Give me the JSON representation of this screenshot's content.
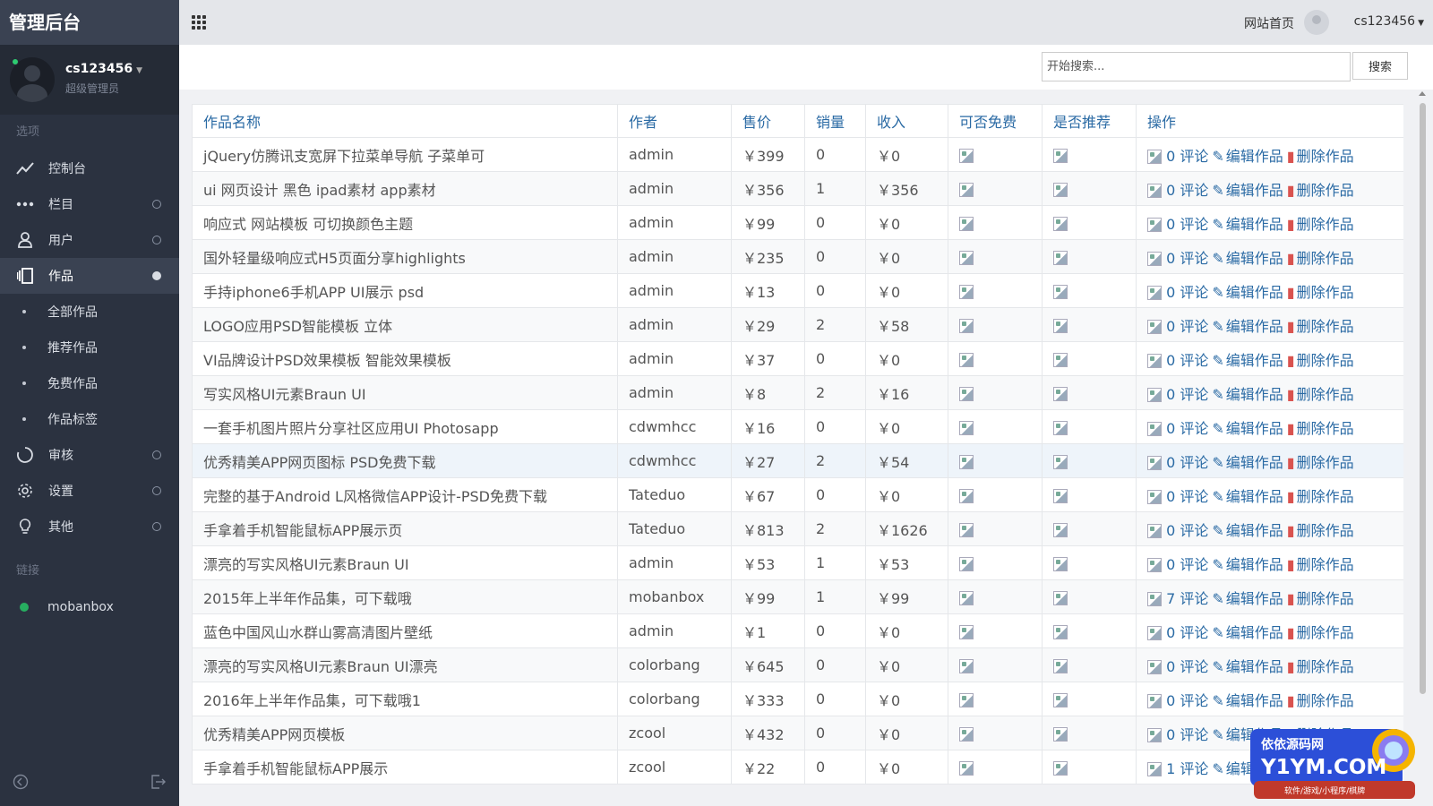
{
  "brand": {
    "title": "管理后台"
  },
  "profile": {
    "name": "cs123456",
    "role": "超级管理员"
  },
  "sidebar": {
    "section_options": "选项",
    "items": [
      {
        "label": "控制台",
        "icon": "trend-icon"
      },
      {
        "label": "栏目",
        "icon": "dots-icon"
      },
      {
        "label": "用户",
        "icon": "user-icon"
      },
      {
        "label": "作品",
        "icon": "works-icon"
      },
      {
        "label": "审核",
        "icon": "spinner-icon"
      },
      {
        "label": "设置",
        "icon": "gear-icon"
      },
      {
        "label": "其他",
        "icon": "bulb-icon"
      }
    ],
    "sub_items": [
      "全部作品",
      "推荐作品",
      "免费作品",
      "作品标签"
    ],
    "section_links": "链接",
    "link": "mobanbox"
  },
  "header": {
    "home_link": "网站首页",
    "user": "cs123456"
  },
  "search": {
    "placeholder": "开始搜索...",
    "button": "搜索"
  },
  "table": {
    "headers": [
      "作品名称",
      "作者",
      "售价",
      "销量",
      "收入",
      "可否免费",
      "是否推荐",
      "操作"
    ],
    "rows": [
      {
        "name": "jQuery仿腾讯支宽屏下拉菜单导航 子菜单可",
        "author": "admin",
        "price": "￥399",
        "sales": "0",
        "income": "￥0",
        "comments": "0 评论"
      },
      {
        "name": "ui 网页设计 黑色 ipad素材 app素材",
        "author": "admin",
        "price": "￥356",
        "sales": "1",
        "income": "￥356",
        "comments": "0 评论"
      },
      {
        "name": "响应式 网站模板 可切换颜色主题",
        "author": "admin",
        "price": "￥99",
        "sales": "0",
        "income": "￥0",
        "comments": "0 评论"
      },
      {
        "name": "国外轻量级响应式H5页面分享highlights",
        "author": "admin",
        "price": "￥235",
        "sales": "0",
        "income": "￥0",
        "comments": "0 评论"
      },
      {
        "name": "手持iphone6手机APP UI展示 psd",
        "author": "admin",
        "price": "￥13",
        "sales": "0",
        "income": "￥0",
        "comments": "0 评论"
      },
      {
        "name": "LOGO应用PSD智能模板 立体",
        "author": "admin",
        "price": "￥29",
        "sales": "2",
        "income": "￥58",
        "comments": "0 评论"
      },
      {
        "name": "VI品牌设计PSD效果模板 智能效果模板",
        "author": "admin",
        "price": "￥37",
        "sales": "0",
        "income": "￥0",
        "comments": "0 评论"
      },
      {
        "name": "写实风格UI元素Braun UI",
        "author": "admin",
        "price": "￥8",
        "sales": "2",
        "income": "￥16",
        "comments": "0 评论"
      },
      {
        "name": "一套手机图片照片分享社区应用UI Photosapp",
        "author": "cdwmhcc",
        "price": "￥16",
        "sales": "0",
        "income": "￥0",
        "comments": "0 评论"
      },
      {
        "name": "优秀精美APP网页图标 PSD免费下载",
        "author": "cdwmhcc",
        "price": "￥27",
        "sales": "2",
        "income": "￥54",
        "comments": "0 评论"
      },
      {
        "name": "完整的基于Android L风格微信APP设计-PSD免费下载",
        "author": "Tateduo",
        "price": "￥67",
        "sales": "0",
        "income": "￥0",
        "comments": "0 评论"
      },
      {
        "name": "手拿着手机智能鼠标APP展示页",
        "author": "Tateduo",
        "price": "￥813",
        "sales": "2",
        "income": "￥1626",
        "comments": "0 评论"
      },
      {
        "name": "漂亮的写实风格UI元素Braun UI",
        "author": "admin",
        "price": "￥53",
        "sales": "1",
        "income": "￥53",
        "comments": "0 评论"
      },
      {
        "name": "2015年上半年作品集，可下载哦",
        "author": "mobanbox",
        "price": "￥99",
        "sales": "1",
        "income": "￥99",
        "comments": "7 评论"
      },
      {
        "name": "蓝色中国风山水群山雾高清图片壁纸",
        "author": "admin",
        "price": "￥1",
        "sales": "0",
        "income": "￥0",
        "comments": "0 评论"
      },
      {
        "name": "漂亮的写实风格UI元素Braun UI漂亮",
        "author": "colorbang",
        "price": "￥645",
        "sales": "0",
        "income": "￥0",
        "comments": "0 评论"
      },
      {
        "name": "2016年上半年作品集，可下载哦1",
        "author": "colorbang",
        "price": "￥333",
        "sales": "0",
        "income": "￥0",
        "comments": "0 评论"
      },
      {
        "name": "优秀精美APP网页模板",
        "author": "zcool",
        "price": "￥432",
        "sales": "0",
        "income": "￥0",
        "comments": "0 评论"
      },
      {
        "name": "手拿着手机智能鼠标APP展示",
        "author": "zcool",
        "price": "￥22",
        "sales": "0",
        "income": "￥0",
        "comments": "1 评论"
      }
    ],
    "edit_label": "编辑作品",
    "delete_label": "删除作品"
  },
  "watermark": {
    "line1": "依依源码网",
    "line2": "Y1YM.COM",
    "line3": "软件/游戏/小程序/棋牌"
  }
}
